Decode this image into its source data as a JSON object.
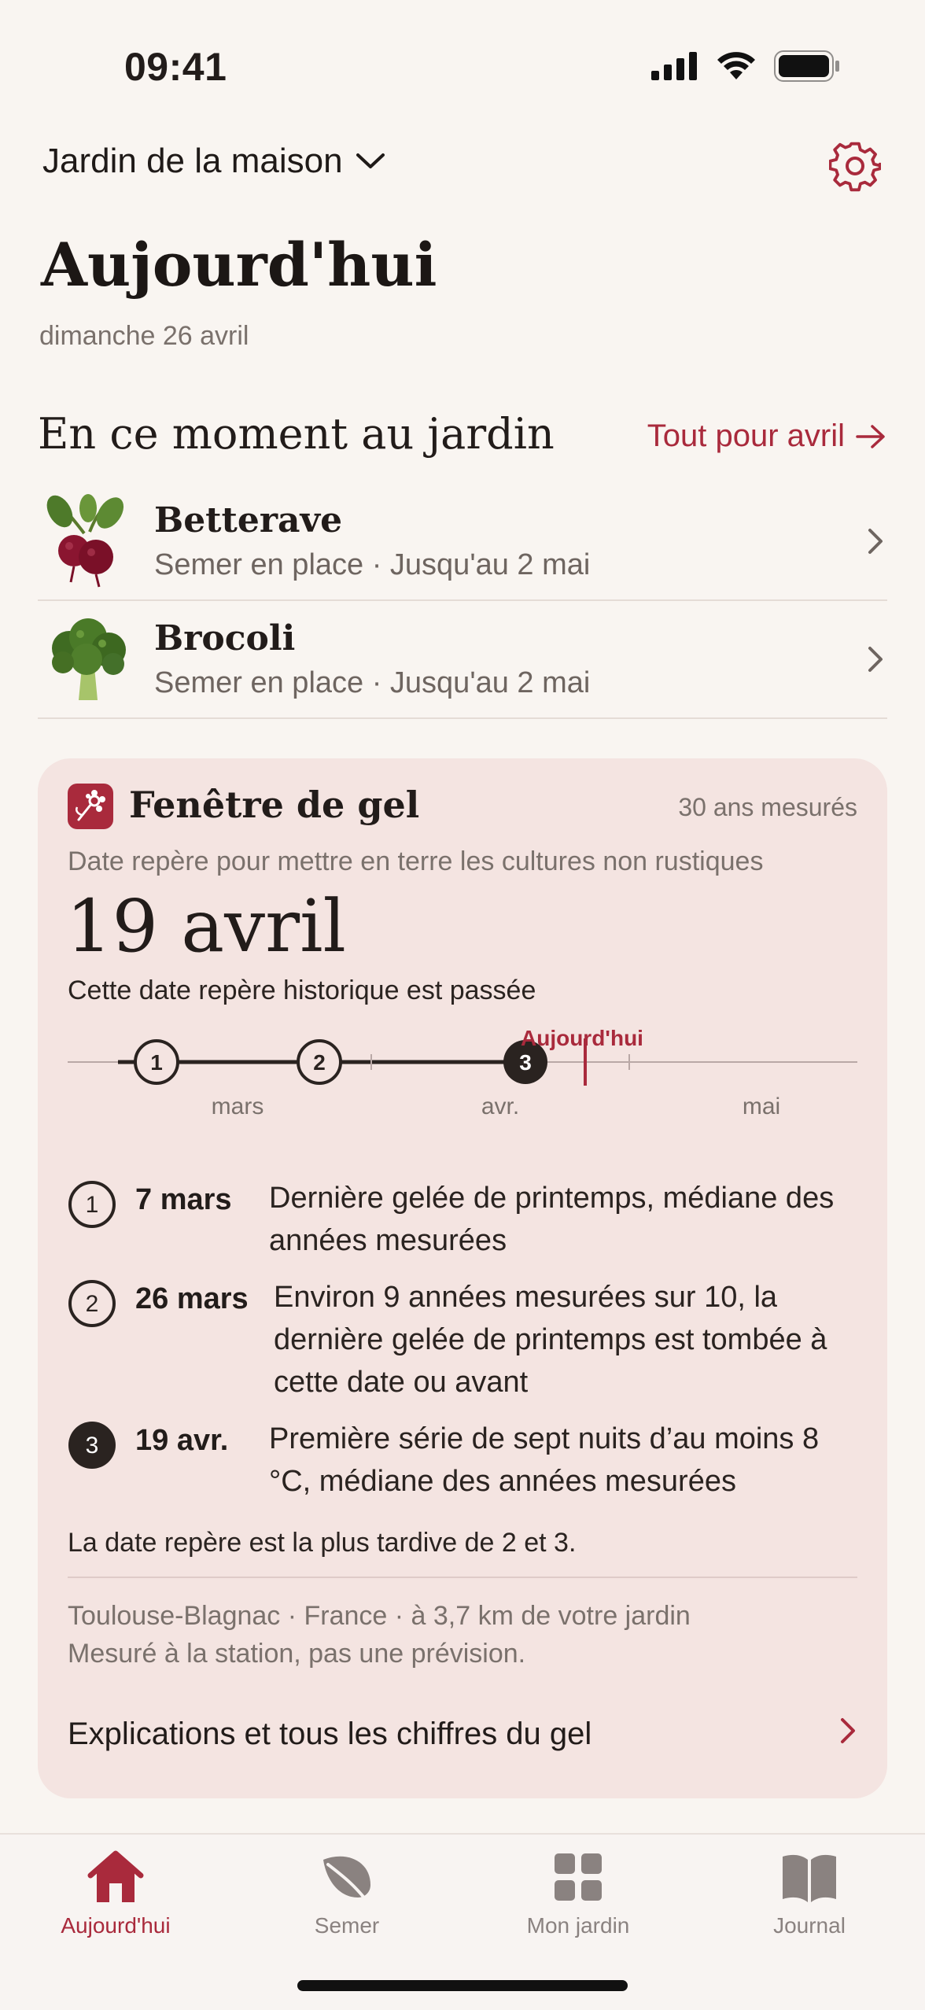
{
  "status": {
    "time": "09:41"
  },
  "header": {
    "garden_name": "Jardin de la maison",
    "title": "Aujourd'hui",
    "date": "dimanche 26 avril"
  },
  "section": {
    "title": "En ce moment au jardin",
    "link": "Tout pour avril"
  },
  "crops": [
    {
      "name": "Betterave",
      "detail": "Semer en place · Jusqu'au 2 mai"
    },
    {
      "name": "Brocoli",
      "detail": "Semer en place · Jusqu'au 2 mai"
    }
  ],
  "frost": {
    "title": "Fenêtre de gel",
    "years": "30 ans mesurés",
    "description": "Date repère pour mettre en terre les cultures non rustiques",
    "date": "19 avril",
    "status": "Cette date repère historique est passée",
    "timeline": {
      "today_label": "Aujourd'hui",
      "months": [
        "mars",
        "avr.",
        "mai"
      ],
      "markers": [
        "1",
        "2",
        "3"
      ]
    },
    "legend": [
      {
        "marker": "1",
        "date": "7 mars",
        "text": "Dernière gelée de printemps, médiane des années mesurées"
      },
      {
        "marker": "2",
        "date": "26 mars",
        "text": "Environ 9 années mesurées sur 10, la dernière gelée de printemps est tombée à cette date ou avant"
      },
      {
        "marker": "3",
        "date": "19 avr.",
        "text": "Première série de sept nuits d’au moins 8 °C, médiane des années mesurées"
      }
    ],
    "note": "La date repère est la plus tardive de 2 et 3.",
    "station_line1": "Toulouse-Blagnac · France · à 3,7 km de votre jardin",
    "station_line2": "Mesuré à la station, pas une prévision.",
    "more_link": "Explications et tous les chiffres du gel"
  },
  "tabs": [
    {
      "label": "Aujourd'hui",
      "icon": "home-icon",
      "active": true
    },
    {
      "label": "Semer",
      "icon": "leaf-icon",
      "active": false
    },
    {
      "label": "Mon jardin",
      "icon": "grid-icon",
      "active": false
    },
    {
      "label": "Journal",
      "icon": "book-icon",
      "active": false
    }
  ],
  "colors": {
    "accent": "#a92a3c",
    "background": "#f9f5f1",
    "card": "#f4e4e1"
  }
}
